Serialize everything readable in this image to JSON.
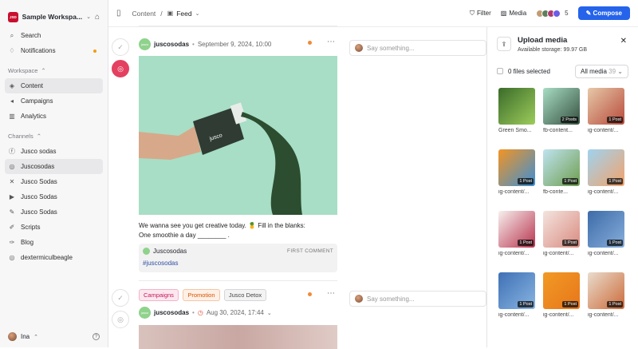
{
  "workspace": {
    "logo_text": "JSD",
    "name": "Sample Workspa...",
    "brand_color": "#c8102e"
  },
  "sidebar": {
    "top_items": [
      {
        "label": "Search",
        "icon": "search-icon"
      },
      {
        "label": "Notifications",
        "icon": "bell-icon"
      }
    ],
    "workspace_section": "Workspace",
    "workspace_items": [
      {
        "label": "Content",
        "icon": "layers-icon",
        "active": true
      },
      {
        "label": "Campaigns",
        "icon": "megaphone-icon"
      },
      {
        "label": "Analytics",
        "icon": "chart-icon"
      }
    ],
    "channels_section": "Channels",
    "channels": [
      {
        "label": "Jusco sodas",
        "icon": "facebook-icon"
      },
      {
        "label": "Juscosodas",
        "icon": "instagram-icon",
        "active": true
      },
      {
        "label": "Jusco Sodas",
        "icon": "x-icon"
      },
      {
        "label": "Jusco Sodas",
        "icon": "youtube-icon"
      },
      {
        "label": "Jusco Sodas",
        "icon": "feather-icon"
      },
      {
        "label": "Scripts",
        "icon": "pen-icon"
      },
      {
        "label": "Blog",
        "icon": "blog-icon"
      },
      {
        "label": "dextermiculbeagle",
        "icon": "instagram-icon"
      }
    ],
    "user": {
      "name": "Ina"
    }
  },
  "topbar": {
    "crumb_content": "Content",
    "crumb_sep": "/",
    "crumb_feed": "Feed",
    "filter": "Filter",
    "media": "Media",
    "collab_count": "5",
    "compose": "Compose",
    "accent": "#2563eb"
  },
  "posts": [
    {
      "account": "juscosodas",
      "date": "September 9, 2024, 10:00",
      "caption_line1": "We wanna see you get creative today. 🍍 Fill in the blanks:",
      "caption_line2": "One smoothie a day ________ .",
      "comment_account": "Juscosodas",
      "comment_label": "FIRST COMMENT",
      "comment_text": "#juscosodas",
      "say_placeholder": "Say something..."
    },
    {
      "tags": [
        "Campaigns",
        "Promotion",
        "Jusco Detox"
      ],
      "account": "juscosodas",
      "date": "Aug 30, 2024, 17:44",
      "say_placeholder": "Say something..."
    }
  ],
  "panel": {
    "title": "Upload media",
    "storage": "Available storage: 99.97 GB",
    "selected": "0 files selected",
    "filter_label": "All media",
    "filter_count": "39",
    "items": [
      {
        "label": "Green Smo...",
        "badge": "",
        "colors": [
          "#3a6b2a",
          "#9ccc5a"
        ]
      },
      {
        "label": "fb-content...",
        "badge": "2 Posts",
        "colors": [
          "#a8ddc4",
          "#35503f"
        ]
      },
      {
        "label": "ig-content/...",
        "badge": "1 Post",
        "colors": [
          "#e6c9a8",
          "#b84a3c"
        ]
      },
      {
        "label": "ig-content/...",
        "badge": "1 Post",
        "colors": [
          "#f39423",
          "#3b8fd6"
        ]
      },
      {
        "label": "fb-conte...",
        "badge": "1 Post",
        "colors": [
          "#bfe3f0",
          "#6e9e4e"
        ]
      },
      {
        "label": "ig-content/...",
        "badge": "1 Post",
        "colors": [
          "#9fd3ef",
          "#f2a36b"
        ]
      },
      {
        "label": "ig-content/...",
        "badge": "1 Post",
        "colors": [
          "#f7f0ee",
          "#b8344e"
        ]
      },
      {
        "label": "ig-content/...",
        "badge": "1 Post",
        "colors": [
          "#f4e4df",
          "#d98b80"
        ]
      },
      {
        "label": "ig-content/...",
        "badge": "1 Post",
        "colors": [
          "#3d6ba8",
          "#87aedc"
        ]
      },
      {
        "label": "ig-content/...",
        "badge": "1 Post",
        "colors": [
          "#3e70b4",
          "#89b5e2"
        ]
      },
      {
        "label": "ig-content/...",
        "badge": "1 Post",
        "colors": [
          "#f19a25",
          "#e8761a"
        ]
      },
      {
        "label": "ig-content/...",
        "badge": "1 Post",
        "colors": [
          "#e9dccd",
          "#cc6b3a"
        ]
      }
    ]
  }
}
